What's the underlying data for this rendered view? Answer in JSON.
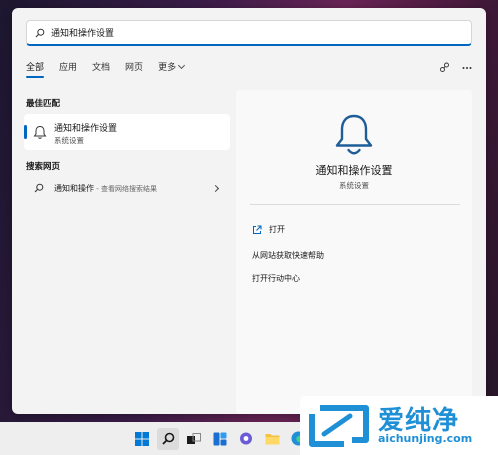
{
  "search": {
    "query": "通知和操作设置"
  },
  "tabs": [
    {
      "label": "全部",
      "active": true
    },
    {
      "label": "应用",
      "active": false
    },
    {
      "label": "文档",
      "active": false
    },
    {
      "label": "网页",
      "active": false
    },
    {
      "label": "更多",
      "active": false,
      "dropdown": true
    }
  ],
  "top_icons": [
    "share-icon",
    "more-options-icon"
  ],
  "best_match": {
    "section_label": "最佳匹配",
    "title": "通知和操作设置",
    "subtitle": "系统设置",
    "icon": "bell-icon"
  },
  "web_search": {
    "section_label": "搜索网页",
    "query": "通知和操作",
    "hint": " - 查看网络搜索结果",
    "icon": "search-icon"
  },
  "detail": {
    "title": "通知和操作设置",
    "subtitle": "系统设置",
    "icon": "bell-icon",
    "actions": [
      {
        "label": "打开",
        "icon": "open-icon"
      },
      {
        "label": "从网站获取快速帮助",
        "icon": ""
      },
      {
        "label": "打开行动中心",
        "icon": ""
      }
    ]
  },
  "taskbar": {
    "items": [
      "start-icon",
      "search-icon",
      "task-view-icon",
      "widgets-icon",
      "chat-icon",
      "file-explorer-icon",
      "edge-icon"
    ]
  },
  "watermark": {
    "brand": "爱纯净",
    "url": "aichunjing.com"
  },
  "colors": {
    "accent": "#0067c0",
    "bell": "#1f5d99",
    "watermark": "#1f8fd6"
  }
}
